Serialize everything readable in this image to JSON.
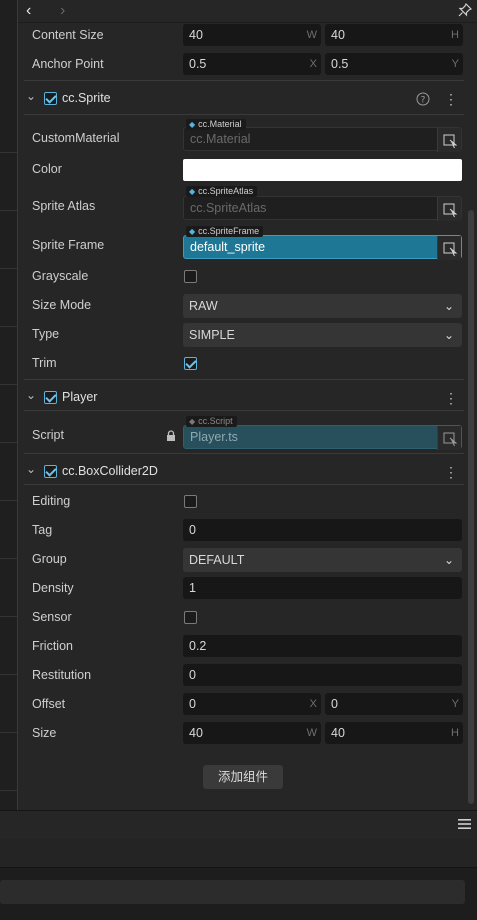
{
  "nav": {
    "back": "‹",
    "forward": "›"
  },
  "icons": {
    "pin": "pin-icon",
    "help": "help-icon",
    "lock": "lock-icon",
    "picker": "asset-picker-icon",
    "menu": "hamburger-menu-icon"
  },
  "node": {
    "content_size": {
      "label": "Content Size",
      "w": "40",
      "w_axis": "W",
      "h": "40",
      "h_axis": "H"
    },
    "anchor_point": {
      "label": "Anchor Point",
      "x": "0.5",
      "x_axis": "X",
      "y": "0.5",
      "y_axis": "Y"
    }
  },
  "sprite": {
    "name": "cc.Sprite",
    "custom_material": {
      "label": "CustomMaterial",
      "tag": "cc.Material",
      "value": "cc.Material"
    },
    "color": {
      "label": "Color",
      "value": "#ffffff"
    },
    "sprite_atlas": {
      "label": "Sprite Atlas",
      "tag": "cc.SpriteAtlas",
      "value": "cc.SpriteAtlas"
    },
    "sprite_frame": {
      "label": "Sprite Frame",
      "tag": "cc.SpriteFrame",
      "value": "default_sprite"
    },
    "grayscale": {
      "label": "Grayscale",
      "checked": false
    },
    "size_mode": {
      "label": "Size Mode",
      "value": "RAW"
    },
    "type": {
      "label": "Type",
      "value": "SIMPLE"
    },
    "trim": {
      "label": "Trim",
      "checked": true
    }
  },
  "player": {
    "name": "Player",
    "script": {
      "label": "Script",
      "tag": "cc.Script",
      "value": "Player.ts"
    }
  },
  "collider": {
    "name": "cc.BoxCollider2D",
    "editing": {
      "label": "Editing",
      "checked": false
    },
    "tag": {
      "label": "Tag",
      "value": "0"
    },
    "group": {
      "label": "Group",
      "value": "DEFAULT"
    },
    "density": {
      "label": "Density",
      "value": "1"
    },
    "sensor": {
      "label": "Sensor",
      "checked": false
    },
    "friction": {
      "label": "Friction",
      "value": "0.2"
    },
    "restitution": {
      "label": "Restitution",
      "value": "0"
    },
    "offset": {
      "label": "Offset",
      "x": "0",
      "x_axis": "X",
      "y": "0",
      "y_axis": "Y"
    },
    "size": {
      "label": "Size",
      "w": "40",
      "w_axis": "W",
      "h": "40",
      "h_axis": "H"
    }
  },
  "add_component": "添加组件",
  "colors": {
    "accent": "#1e7795",
    "check": "#6cc4ea",
    "panel": "#262626"
  }
}
